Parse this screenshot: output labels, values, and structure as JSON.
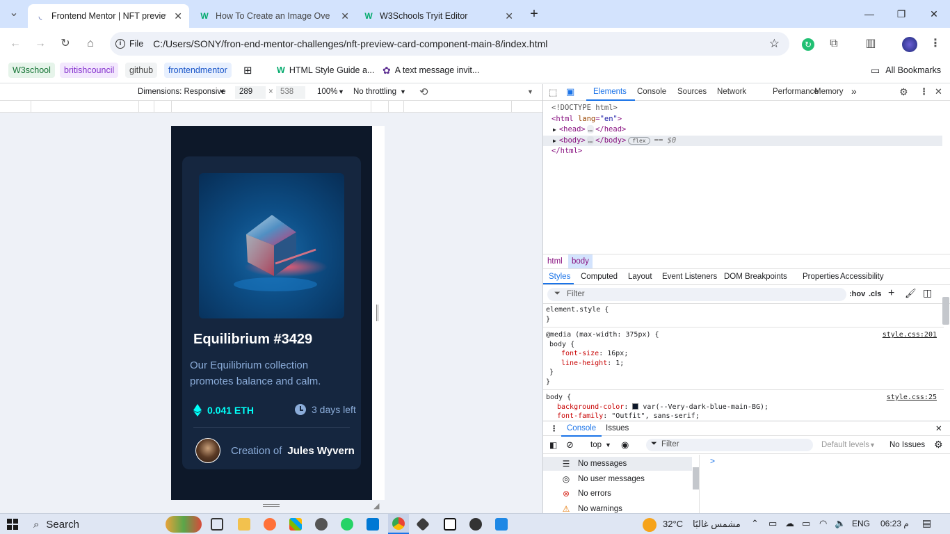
{
  "tabs": [
    {
      "title": "Frontend Mentor | NFT preview",
      "icon": "frontendmentor-icon"
    },
    {
      "title": "How To Create an Image Overla",
      "icon": "w3schools-icon"
    },
    {
      "title": "W3Schools Tryit Editor",
      "icon": "w3schools-icon"
    }
  ],
  "address": {
    "scheme_label": "File",
    "url": "C:/Users/SONY/fron-end-mentor-challenges/nft-preview-card-component-main-8/index.html"
  },
  "bookmarks": [
    "W3school",
    "britishcouncil",
    "github",
    "frontendmentor",
    "HTML Style Guide a...",
    "A text message invit..."
  ],
  "all_bookmarks": "All Bookmarks",
  "devbar": {
    "dimensions": "Dimensions: Responsive",
    "width": "289",
    "times": "×",
    "height": "538",
    "zoom": "100%",
    "throttling": "No throttling"
  },
  "card": {
    "title": "Equilibrium #3429",
    "description": "Our Equilibrium collection promotes balance and calm.",
    "price": "0.041 ETH",
    "time_left": "3 days left",
    "creation_prefix": "Creation of",
    "creator": "Jules Wyvern"
  },
  "devtools": {
    "tabs": [
      "Elements",
      "Console",
      "Sources",
      "Network",
      "Performance",
      "Memory"
    ],
    "more": "»",
    "dom": {
      "doctype": "<!DOCTYPE html>",
      "html_open": "<html",
      "lang_attr": "lang",
      "lang_val": "\"en\"",
      "head": "<head>",
      "head_close": "</head>",
      "body": "<body>",
      "body_close": "</body>",
      "flex_badge": "flex",
      "sel": "== $0",
      "html_close": "</html>",
      "ellipsis": "…"
    },
    "crumbs": [
      "html",
      "body"
    ],
    "subtabs": [
      "Styles",
      "Computed",
      "Layout",
      "Event Listeners",
      "DOM Breakpoints",
      "Properties",
      "Accessibility"
    ],
    "filter": "Filter",
    "hov": ":hov",
    "cls": ".cls",
    "styles": {
      "element_style": "element.style {",
      "close": "}",
      "media": "@media (max-width: 375px) {",
      "media_src": "style.css:201",
      "body_sel": "body {",
      "fs_prop": "font-size",
      "fs_val": "16px;",
      "lh_prop": "line-height",
      "lh_val": "1;",
      "body2_src": "style.css:25",
      "bg_prop": "background-color",
      "bg_val": "var(--Very-dark-blue-main-BG);",
      "ff_prop": "font-family",
      "ff_val": "\"Outfit\", sans-serif;"
    },
    "console": {
      "tabs": [
        "Console",
        "Issues"
      ],
      "context": "top",
      "filter": "Filter",
      "levels": "Default levels",
      "issues": "No Issues",
      "items": [
        "No messages",
        "No user messages",
        "No errors",
        "No warnings"
      ],
      "prompt": ">"
    }
  },
  "taskbar": {
    "search": "Search",
    "weather": "32°C",
    "weather_text": "مشمس غالبًا",
    "lang": "ENG",
    "time": "06:23 م"
  },
  "colors": {
    "page_bg": "#0d1829",
    "card_bg": "#15263f",
    "cyan": "#00fff8",
    "soft_blue": "#8bacd9",
    "accent_blue": "#1a73e8"
  }
}
